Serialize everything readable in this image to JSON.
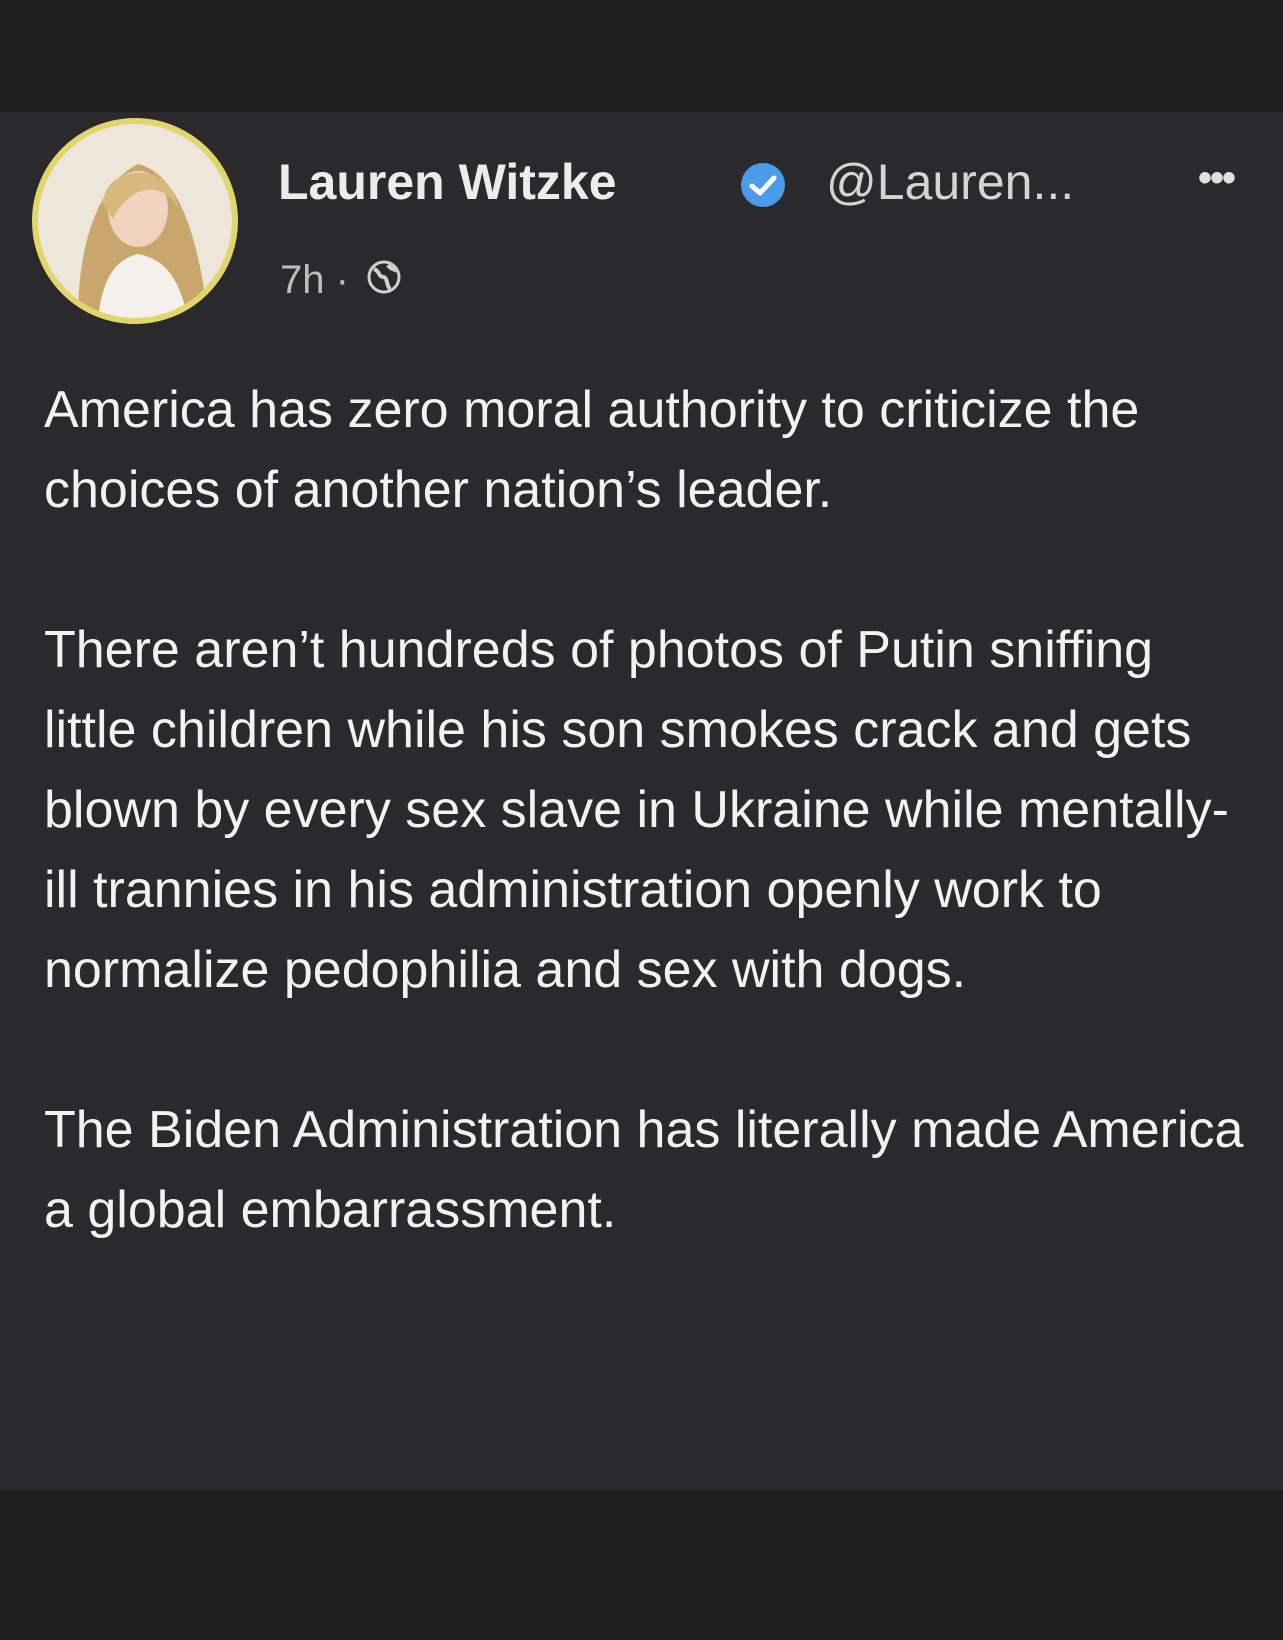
{
  "post": {
    "author": {
      "name": "Lauren Witzke",
      "handle": "@Lauren...",
      "verified": true,
      "avatar_icon": "profile-photo"
    },
    "meta": {
      "time": "7h",
      "separator": "·",
      "audience_icon": "globe-icon"
    },
    "more_icon": "more-options-icon",
    "paragraphs": [
      "America has zero moral authority to criticize the choices of another nation’s leader.",
      "There aren’t hundreds of photos of Putin sniffing little children while his son smokes crack and gets blown by every sex slave in Ukraine while mentally-ill trannies in his administration openly work to normalize pedophilia and sex with dogs.",
      "The Biden Administration has literally made America a global embarrassment."
    ]
  },
  "colors": {
    "background": "#2a2a2c",
    "text": "#f2f2f2",
    "verified_badge": "#4a9be8",
    "avatar_ring": "#e2d66a"
  }
}
